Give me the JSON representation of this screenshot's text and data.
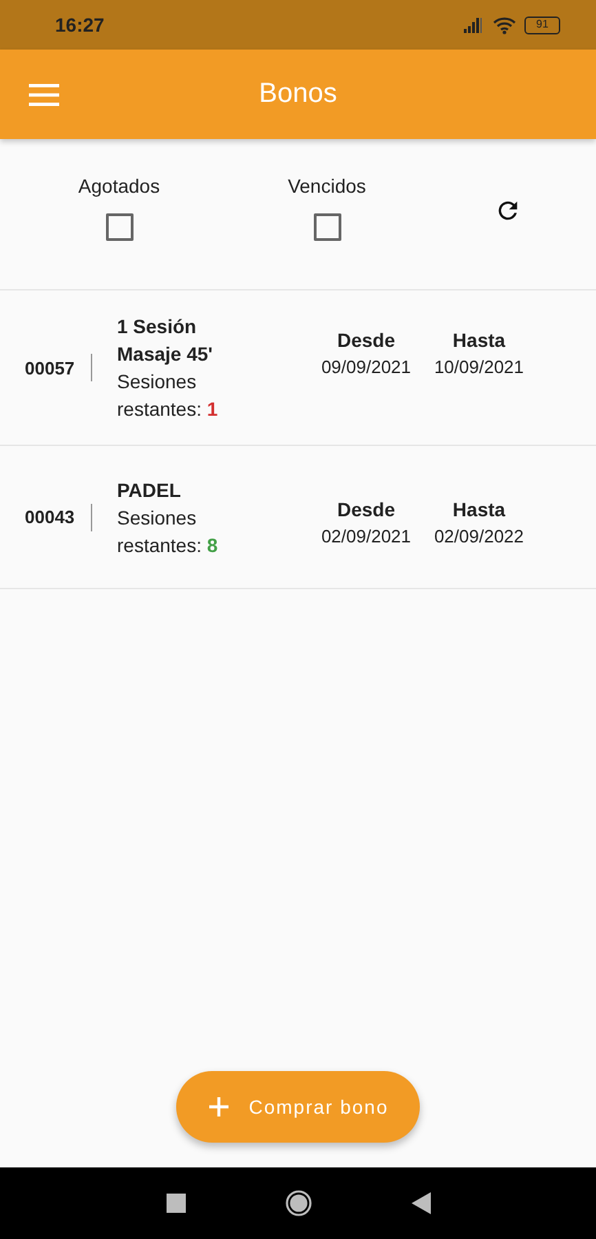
{
  "status_bar": {
    "time": "16:27",
    "battery": "91"
  },
  "app_bar": {
    "title": "Bonos"
  },
  "filters": [
    {
      "label": "Agotados",
      "checked": false
    },
    {
      "label": "Vencidos",
      "checked": false
    }
  ],
  "bonos": [
    {
      "code": "00057",
      "name": "1 Sesión Masaje 45'",
      "remaining_label": "Sesiones restantes:",
      "remaining": "1",
      "color": "#d32f2f",
      "from_label": "Desde",
      "from": "09/09/2021",
      "to_label": "Hasta",
      "to": "10/09/2021"
    },
    {
      "code": "00043",
      "name": "PADEL",
      "remaining_label": "Sesiones restantes:",
      "remaining": "8",
      "color": "#43a047",
      "from_label": "Desde",
      "from": "02/09/2021",
      "to_label": "Hasta",
      "to": "02/09/2022"
    }
  ],
  "fab": {
    "label": "Comprar bono"
  }
}
